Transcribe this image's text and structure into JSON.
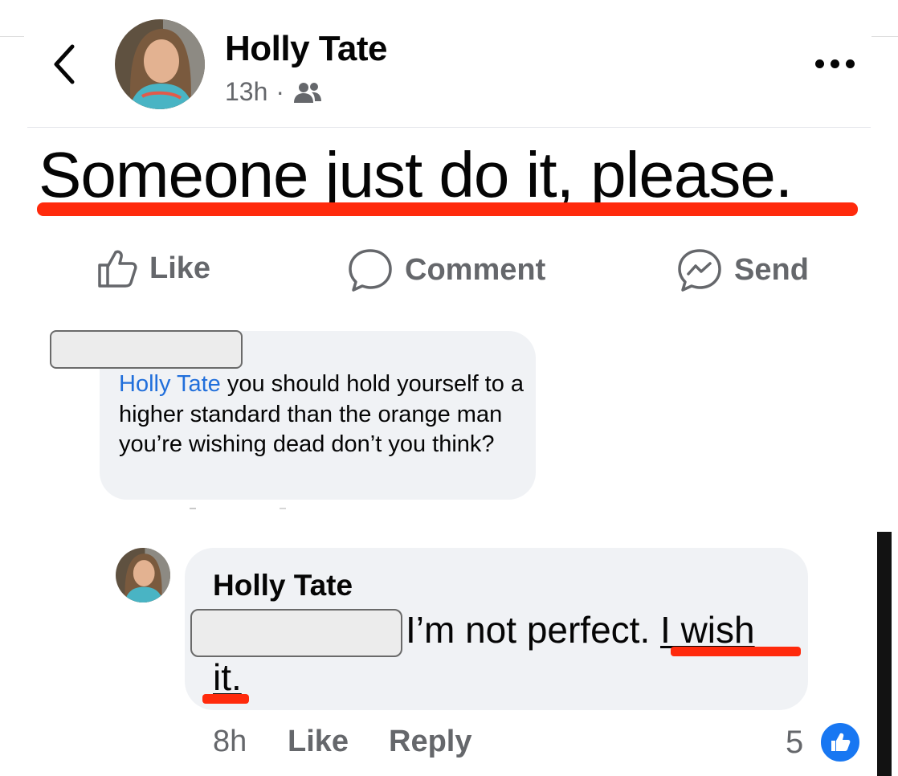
{
  "post": {
    "author": "Holly Tate",
    "time": "13h",
    "separator": "·",
    "audience_icon": "friends-icon",
    "text": "Someone just do it, please."
  },
  "actions": {
    "like": "Like",
    "comment": "Comment",
    "send": "Send"
  },
  "comment": {
    "mention": "Holly Tate",
    "text": " you should hold yourself to a higher standard than the orange man you’re wishing dead don’t you think?"
  },
  "reply": {
    "author": "Holly Tate",
    "line1_plain": "I’m not perfect. ",
    "line1_underlined": "I wish",
    "line2": "it.",
    "time": "8h",
    "like": "Like",
    "reply": "Reply",
    "reactions": "5"
  },
  "colors": {
    "accent": "#1877f2",
    "highlight": "#ff2a0c",
    "bubble": "#f0f2f5",
    "secondary_text": "#65676b"
  }
}
